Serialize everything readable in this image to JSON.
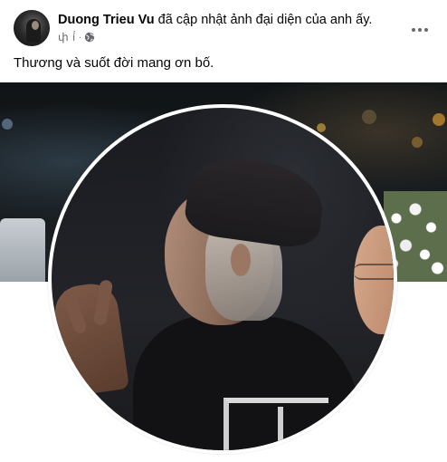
{
  "post": {
    "author_name": "Duong Trieu Vu",
    "action_text": "đã cập nhật ảnh đại diện của anh ấy.",
    "timestamp": "փ í́",
    "privacy_icon": "globe-icon",
    "more_label": "•••",
    "caption": "Thương và suốt đời mang ơn bố."
  },
  "colors": {
    "text_primary": "#050505",
    "text_secondary": "#65676b",
    "background": "#ffffff"
  }
}
